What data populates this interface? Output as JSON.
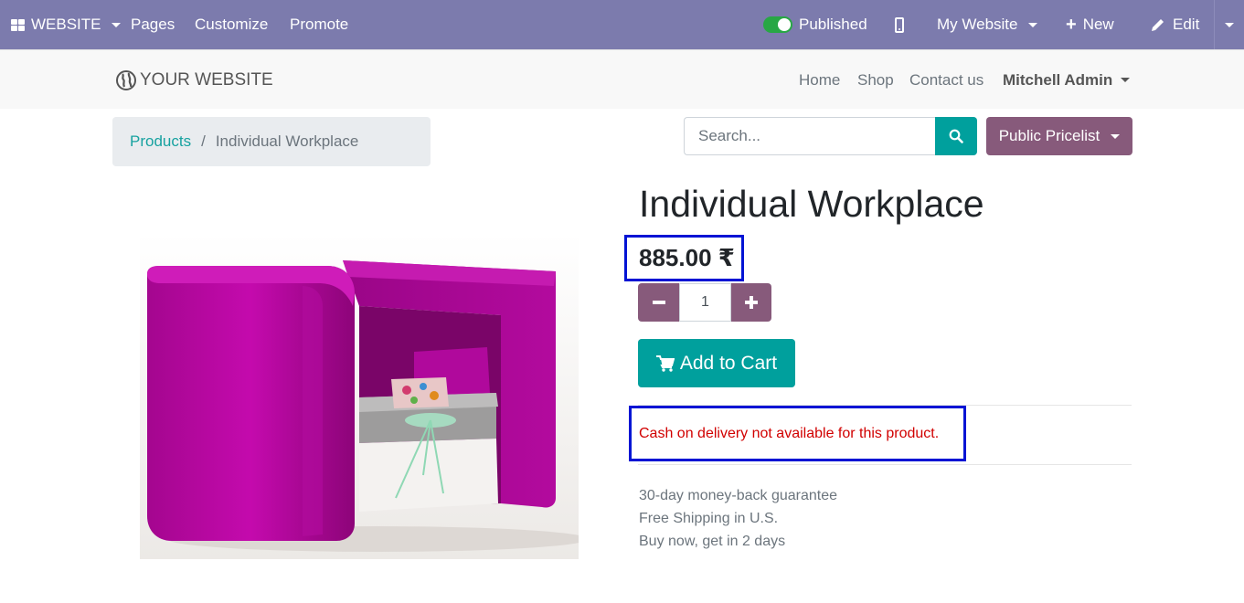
{
  "editor_bar": {
    "website_menu": "WEBSITE",
    "pages": "Pages",
    "customize": "Customize",
    "promote": "Promote",
    "published": "Published",
    "my_website": "My Website",
    "new": "New",
    "edit": "Edit"
  },
  "header": {
    "logo_text": "YOUR WEBSITE",
    "nav": [
      "Home",
      "Shop",
      "Contact us"
    ],
    "user": "Mitchell Admin"
  },
  "breadcrumb": {
    "parent": "Products",
    "separator": "/",
    "current": "Individual Workplace"
  },
  "search": {
    "placeholder": "Search..."
  },
  "pricelist": {
    "label": "Public Pricelist"
  },
  "product": {
    "name": "Individual Workplace",
    "price": "885.00 ₹",
    "quantity": "1",
    "add_to_cart": "Add to Cart",
    "cod_message": "Cash on delivery not available for this product.",
    "terms": [
      "30-day money-back guarantee",
      "Free Shipping in U.S.",
      "Buy now, get in 2 days"
    ]
  },
  "colors": {
    "editor_bar": "#7c7bad",
    "primary": "#875a7b",
    "secondary": "#00a09d",
    "highlight_border": "#0014d4",
    "cod_text": "#d10000"
  }
}
